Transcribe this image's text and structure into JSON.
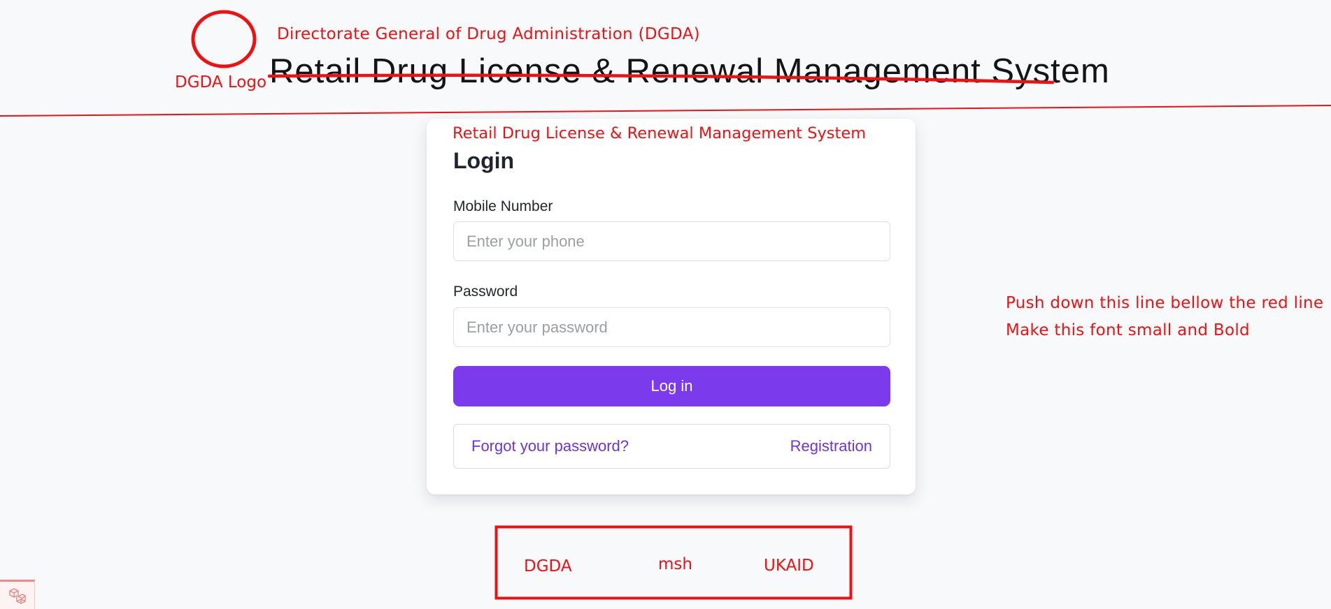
{
  "header": {
    "org_name": "Directorate General of Drug Administration (DGDA)",
    "logo_label": "DGDA Logo",
    "system_title": "Retail Drug License & Renewal Management System"
  },
  "login_card": {
    "subtitle": "Retail Drug License & Renewal Management System",
    "heading": "Login",
    "phone_label": "Mobile Number",
    "phone_placeholder": "Enter your phone",
    "password_label": "Password",
    "password_placeholder": "Enter your password",
    "login_button": "Log in",
    "forgot_link": "Forgot your password?",
    "register_link": "Registration"
  },
  "notes": {
    "line1": "Push down this line bellow the red line",
    "line2": "Make this font small and Bold"
  },
  "partners": [
    "DGDA",
    "msh",
    "UKAID"
  ],
  "colors": {
    "annotation_red": "#ee1111",
    "primary_button": "#7c3aed",
    "link": "#6d33e0",
    "background": "#f8f9fb"
  },
  "icons": {
    "corner": "laravel-icon"
  }
}
